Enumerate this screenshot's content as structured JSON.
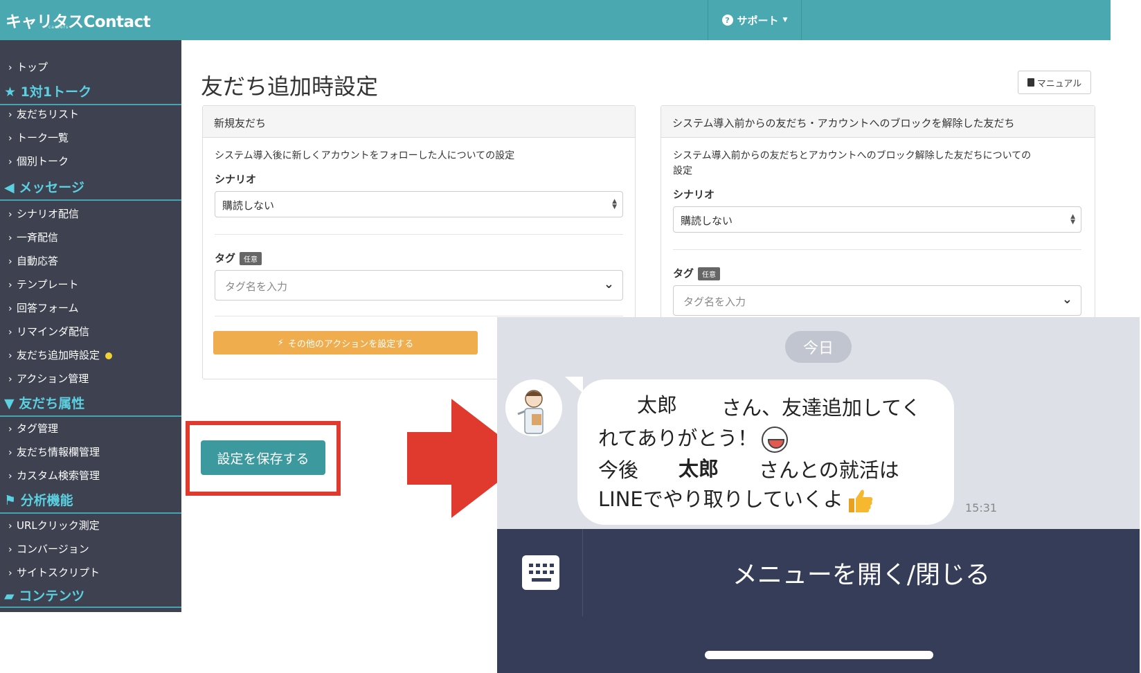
{
  "header": {
    "logo": "キャリタスContact",
    "logo_sub": "careers",
    "support_label": "サポート"
  },
  "sidebar": {
    "items": [
      {
        "label": "トップ"
      },
      {
        "label": "友だちリスト"
      },
      {
        "label": "トーク一覧"
      },
      {
        "label": "個別トーク"
      },
      {
        "label": "シナリオ配信"
      },
      {
        "label": "一斉配信"
      },
      {
        "label": "自動応答"
      },
      {
        "label": "テンプレート"
      },
      {
        "label": "回答フォーム"
      },
      {
        "label": "リマインダ配信"
      },
      {
        "label": "友だち追加時設定"
      },
      {
        "label": "アクション管理"
      },
      {
        "label": "タグ管理"
      },
      {
        "label": "友だち情報欄管理"
      },
      {
        "label": "カスタム検索管理"
      },
      {
        "label": "URLクリック測定"
      },
      {
        "label": "コンバージョン"
      },
      {
        "label": "サイトスクリプト"
      }
    ],
    "sections": {
      "talk": "1対1トーク",
      "message": "メッセージ",
      "attributes": "友だち属性",
      "analytics": "分析機能",
      "contents": "コンテンツ"
    }
  },
  "main": {
    "title": "友だち追加時設定",
    "manual_label": "マニュアル",
    "panel_new": {
      "heading": "新規友だち",
      "description": "システム導入後に新しくアカウントをフォローした人についての設定",
      "scenario_label": "シナリオ",
      "scenario_value": "購読しない",
      "tag_label": "タグ",
      "tag_badge": "任意",
      "tag_placeholder": "タグ名を入力",
      "action_button": "その他のアクションを設定する"
    },
    "panel_existing": {
      "heading": "システム導入前からの友だち・アカウントへのブロックを解除した友だち",
      "description_1": "システム導入前からの友だちとアカウントへのブロック解除した友だちについての",
      "description_2": "設定",
      "scenario_label": "シナリオ",
      "scenario_value": "購読しない",
      "tag_label": "タグ",
      "tag_badge": "任意",
      "tag_placeholder": "タグ名を入力"
    },
    "save_button": "設定を保存する"
  },
  "line_chat": {
    "date_chip": "今日",
    "msg_line1_name": "太郎",
    "msg_line1_rest": "さん、友達追加してく",
    "msg_line2": "れてありがとう！",
    "msg_line3_pre": "今後",
    "msg_line3_name": "太郎",
    "msg_line3_rest": "さんとの就活は",
    "msg_line4": "LINEでやり取りしていくよ",
    "time": "15:31",
    "menu_label": "メニューを開く/閉じる"
  },
  "colors": {
    "header": "#4aa8b0",
    "sidebar": "#3d4150",
    "sidebar_heading": "#5bd0e0",
    "save_button": "#3c9a9e",
    "action_button": "#f0ad4e",
    "highlight": "#e03a2f",
    "line_bar": "#353d59"
  }
}
